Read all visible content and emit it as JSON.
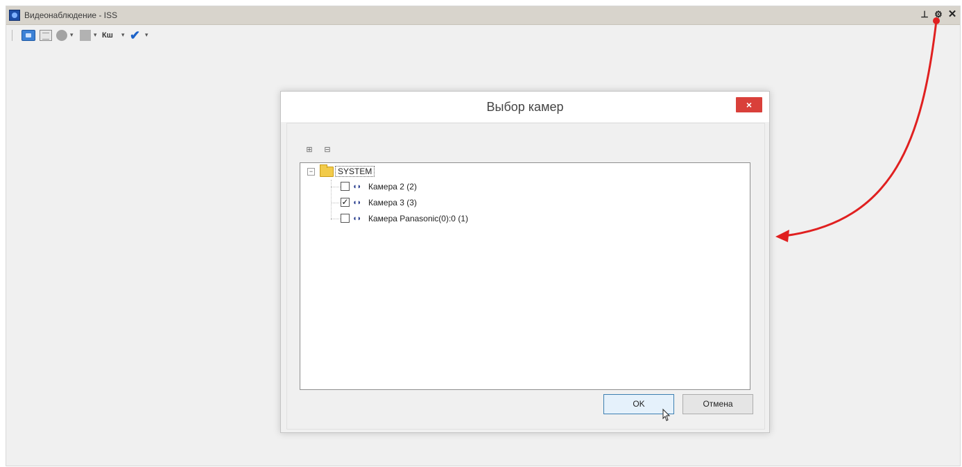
{
  "window": {
    "title": "Видеонаблюдение - ISS",
    "pin_icon": "pin-icon",
    "gear_icon": "gear-icon",
    "close_icon": "close-icon"
  },
  "toolbar": {
    "items": [
      "camera-view-icon",
      "layout-grid-icon",
      "globe-icon",
      "square-icon",
      "text-tool-icon",
      "checkmark-icon"
    ],
    "text_tool_label": "Кш"
  },
  "dialog": {
    "title": "Выбор камер",
    "close_label": "×",
    "expand_all_label": "⊞",
    "collapse_all_label": "⊟",
    "tree": {
      "root": {
        "label": "SYSTEM",
        "expanded": true
      },
      "items": [
        {
          "label": "Камера 2 (2)",
          "checked": false
        },
        {
          "label": "Камера 3 (3)",
          "checked": true
        },
        {
          "label": "Камера Panasonic(0):0 (1)",
          "checked": false
        }
      ]
    },
    "ok_label": "OK",
    "cancel_label": "Отмена"
  },
  "colors": {
    "accent": "#3d82d6",
    "close_button": "#d9403a",
    "annotation_arrow": "#e02020",
    "folder": "#f2cb4a"
  }
}
